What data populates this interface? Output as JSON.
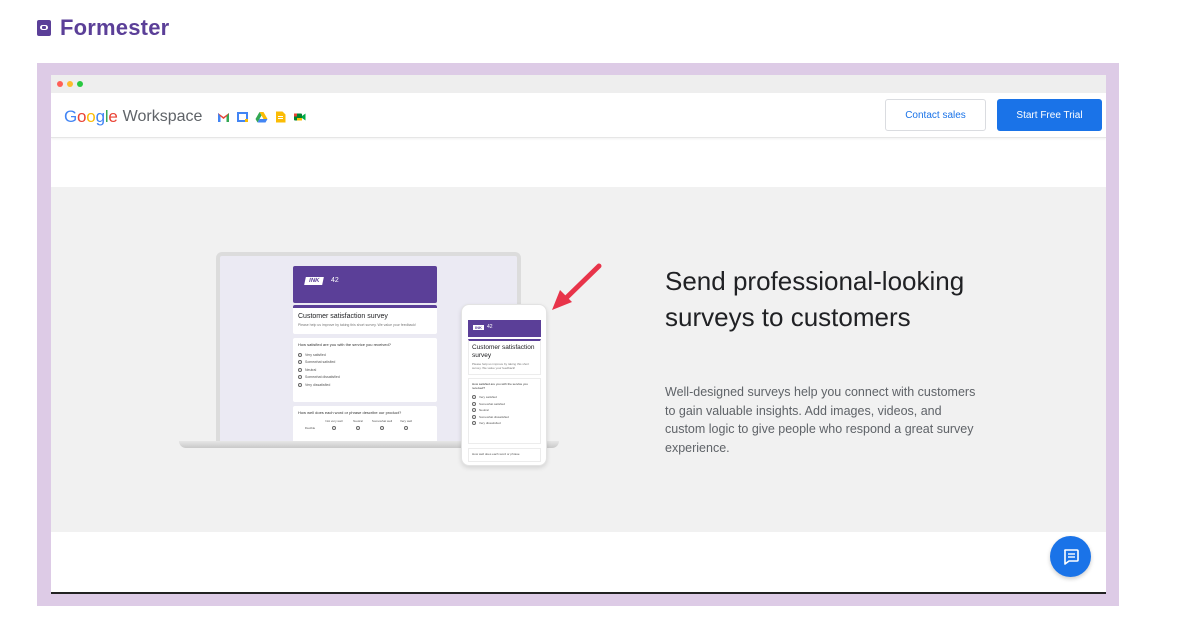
{
  "brand": {
    "name": "Formester",
    "logo_icon": "formester-logo-icon"
  },
  "browser": {
    "window_controls": [
      "close",
      "minimize",
      "maximize"
    ]
  },
  "header": {
    "logo_google": "Google",
    "logo_workspace": "Workspace",
    "app_icons": [
      "gmail-icon",
      "calendar-icon",
      "drive-icon",
      "docs-icon",
      "meet-icon"
    ],
    "contact_label": "Contact sales",
    "trial_label": "Start Free Trial"
  },
  "hero": {
    "headline": "Send professional-looking surveys to customers",
    "description": "Well-designed surveys help you connect with customers to gain valuable insights. Add images, videos, and custom logic to give people who respond a great survey experience."
  },
  "mockup": {
    "badge": "INK",
    "badge_number": "42",
    "form_title": "Customer satisfaction survey",
    "form_subtitle": "Please help us improve by taking this short survey. We value your feedback!",
    "question1": "How satisfied are you with the service you received?",
    "options": [
      "Very satisfied",
      "Somewhat satisfied",
      "Neutral",
      "Somewhat dissatisfied",
      "Very dissatisfied"
    ],
    "question2": "How well does each word or phrase describe our product?",
    "grid_columns": [
      "Not very well",
      "Neutral",
      "Somewhat well",
      "Very well"
    ],
    "grid_row": "Flexible",
    "phone_title": "Customer satisfaction survey",
    "phone_subtitle": "Please help us improve by taking this short survey. We value your feedback!",
    "phone_question": "How satisfied are you with the service you received?",
    "phone_footer": "How well does each word or phrase"
  },
  "colors": {
    "brand_purple": "#5b3f98",
    "accent_blue": "#1a73e8",
    "arrow_red": "#e8344a"
  }
}
